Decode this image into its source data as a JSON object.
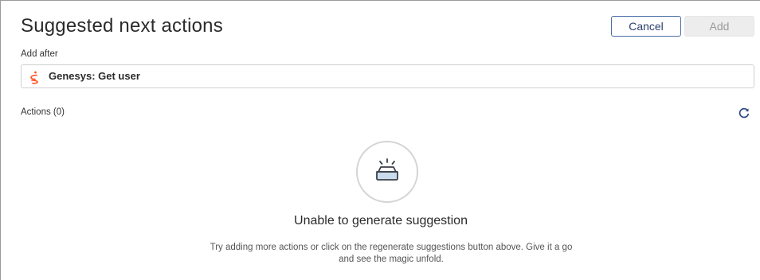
{
  "header": {
    "title": "Suggested next actions",
    "cancel_label": "Cancel",
    "add_label": "Add"
  },
  "add_after": {
    "label": "Add after",
    "value": "Genesys: Get user",
    "icon": "genesys-logo-icon",
    "icon_color": "#ff4f1f"
  },
  "actions": {
    "label": "Actions (0)",
    "refresh_icon": "regenerate-icon"
  },
  "empty_state": {
    "icon": "empty-tray-icon",
    "title": "Unable to generate suggestion",
    "description": "Try adding more actions or click on the regenerate suggestions button above. Give it a go and see the magic unfold."
  },
  "colors": {
    "accent": "#4a6ea8",
    "disabled_button_bg": "#ededed"
  }
}
